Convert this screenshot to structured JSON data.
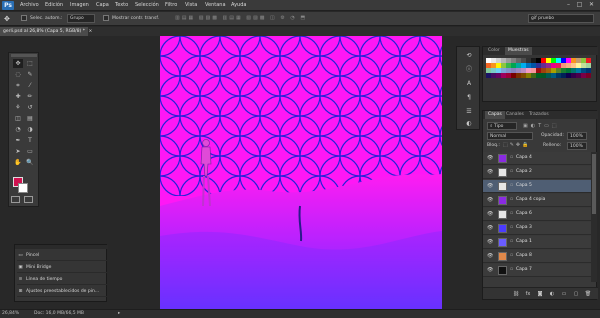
{
  "colors": {
    "canvas_magenta": "#ff17f5",
    "accent_blue": "#2a6fb5",
    "foreground_swatch": "#d01350",
    "selected_row": "#4f5e73"
  },
  "app": {
    "logo": "Ps"
  },
  "menu": [
    "Archivo",
    "Edición",
    "Imagen",
    "Capa",
    "Texto",
    "Selección",
    "Filtro",
    "Vista",
    "Ventana",
    "Ayuda"
  ],
  "window_controls": {
    "minimize": "–",
    "maximize": "□",
    "close": "✕"
  },
  "options": {
    "sample_label": "Selec. autom.:",
    "sample_value": "Grupo",
    "show_transform": "Mostrar contr. transf.",
    "workspace": "gif pruebo"
  },
  "document_tab": {
    "title": "gerli.psd al 26,8% (Capa 5, RGB/8) *",
    "close": "×"
  },
  "tools": [
    "move-icon",
    "marquee-icon",
    "lasso-icon",
    "quick-select-icon",
    "crop-icon",
    "eyedropper-icon",
    "healing-icon",
    "brush-icon",
    "clone-icon",
    "history-brush-icon",
    "eraser-icon",
    "gradient-icon",
    "blur-icon",
    "dodge-icon",
    "pen-icon",
    "type-icon",
    "path-select-icon",
    "shape-icon",
    "hand-icon",
    "zoom-icon"
  ],
  "tool_glyphs": [
    "✥",
    "⬚",
    "◌",
    "✎",
    "⌗",
    "⁄",
    "✚",
    "✏",
    "⚘",
    "↺",
    "◫",
    "▤",
    "◔",
    "◑",
    "✒",
    "T",
    "➤",
    "▭",
    "✋",
    "🔍"
  ],
  "mini_panel": {
    "items": [
      {
        "icon": "▭",
        "label": "Pincel"
      },
      {
        "icon": "▣",
        "label": "Mini Bridge"
      },
      {
        "icon": "≡",
        "label": "Línea de tiempo"
      },
      {
        "icon": "⊞",
        "label": "Ajustes preestablecidos de pin..."
      }
    ]
  },
  "status": {
    "zoom": "26,84%",
    "doc": "Doc: 16,0 MB/66,5 MB",
    "arrow": "▸"
  },
  "color_panel": {
    "tabs": [
      "Color",
      "Muestras"
    ],
    "active_tab": 1
  },
  "swatches": [
    "#ffffff",
    "#e8e8e8",
    "#cfcfcf",
    "#b5b5b5",
    "#9a9a9a",
    "#808080",
    "#666",
    "#4d4d4d",
    "#333",
    "#1a1a1a",
    "#000",
    "#ff0000",
    "#ffff00",
    "#00ff00",
    "#00ffff",
    "#0000ff",
    "#ff00ff",
    "#f7941d",
    "#c69c6d",
    "#8dc63f",
    "#ed1c24",
    "#f26522",
    "#f7941d",
    "#fff200",
    "#8dc63f",
    "#39b54a",
    "#00a651",
    "#00a99d",
    "#00aeef",
    "#0072bc",
    "#0054a6",
    "#2e3192",
    "#662d91",
    "#92278f",
    "#ec008c",
    "#ed145b",
    "#f69679",
    "#f9ad81",
    "#fdc68a",
    "#fff799",
    "#c4df9b",
    "#a3d39c",
    "#82ca9c",
    "#7accc8",
    "#6dcff6",
    "#7da7d9",
    "#8393ca",
    "#8781bd",
    "#a187be",
    "#bd8cbf",
    "#f49ac1",
    "#f5989d",
    "#9e0b0f",
    "#a0410d",
    "#a36209",
    "#aba000",
    "#598527",
    "#1a7b30",
    "#007236",
    "#00746b",
    "#0076a3",
    "#004b80",
    "#003471",
    "#1b1464",
    "#440e62",
    "#630460",
    "#9e005d",
    "#9e0039",
    "#790000",
    "#7b2e00",
    "#7d4900",
    "#827b00",
    "#406618",
    "#005e20",
    "#005826",
    "#005952",
    "#005b7f",
    "#003663",
    "#002157",
    "#0d004c",
    "#32004b",
    "#4b0049",
    "#7b0046",
    "#7a0026"
  ],
  "layers_panel": {
    "tabs": [
      "Capas",
      "Canales",
      "Trazados"
    ],
    "filter_label": "Tipo",
    "blend_mode": "Normal",
    "opacity_label": "Opacidad:",
    "opacity_value": "100%",
    "lock_label": "Bloq.:",
    "fill_label": "Relleno:",
    "fill_value": "100%",
    "layers": [
      {
        "name": "Capa 4",
        "thumb": "#8a2be2",
        "selected": false
      },
      {
        "name": "Capa 2",
        "thumb": "#e6e6e6",
        "selected": false
      },
      {
        "name": "Capa 5",
        "thumb": "#e6e6e6",
        "selected": true
      },
      {
        "name": "Capa 4 copia",
        "thumb": "#8a2be2",
        "selected": false
      },
      {
        "name": "Capa 6",
        "thumb": "#e6e6e6",
        "selected": false
      },
      {
        "name": "Capa 3",
        "thumb": "#4b3bff",
        "selected": false
      },
      {
        "name": "Capa 1",
        "thumb": "#6a5cff",
        "selected": false
      },
      {
        "name": "Capa 8",
        "thumb": "#e0884a",
        "selected": false
      },
      {
        "name": "Capa 7",
        "thumb": "#111",
        "selected": false
      }
    ],
    "footer_icons": [
      "link-icon",
      "fx-icon",
      "mask-icon",
      "adjustment-icon",
      "group-icon",
      "new-layer-icon",
      "trash-icon"
    ],
    "footer_glyphs": [
      "⛓",
      "fx",
      "◙",
      "◐",
      "▭",
      "▢",
      "🗑"
    ]
  }
}
